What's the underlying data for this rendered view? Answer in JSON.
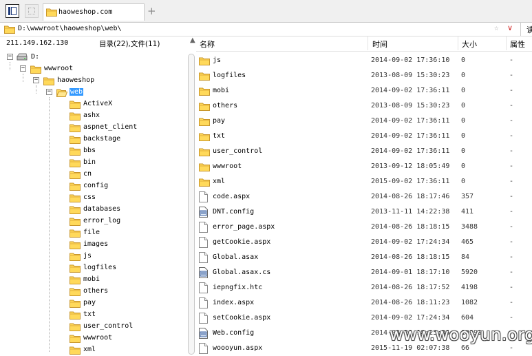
{
  "tab": {
    "title": "haoweshop.com",
    "plus": "+"
  },
  "address": {
    "path": "D:\\wwwroot\\haoweshop\\web\\",
    "star": "☆",
    "chevron": "∨",
    "go": "读"
  },
  "status": {
    "ip": "211.149.162.130",
    "counts": "目录(22),文件(11)"
  },
  "columns": {
    "name": "名称",
    "time": "时间",
    "size": "大小",
    "attr": "属性"
  },
  "tree": {
    "drive": "D:",
    "wwwroot": "wwwroot",
    "haoweshop": "haoweshop",
    "web": "web",
    "children": [
      "ActiveX",
      "ashx",
      "aspnet_client",
      "backstage",
      "bbs",
      "bin",
      "cn",
      "config",
      "css",
      "databases",
      "error_log",
      "file",
      "images",
      "js",
      "logfiles",
      "mobi",
      "others",
      "pay",
      "txt",
      "user_control",
      "wwwroot",
      "xml"
    ]
  },
  "files": [
    {
      "name": "js",
      "time": "2014-09-02 17:36:10",
      "size": "0",
      "attr": "-",
      "type": "folder"
    },
    {
      "name": "logfiles",
      "time": "2013-08-09 15:30:23",
      "size": "0",
      "attr": "-",
      "type": "folder"
    },
    {
      "name": "mobi",
      "time": "2014-09-02 17:36:11",
      "size": "0",
      "attr": "-",
      "type": "folder"
    },
    {
      "name": "others",
      "time": "2013-08-09 15:30:23",
      "size": "0",
      "attr": "-",
      "type": "folder"
    },
    {
      "name": "pay",
      "time": "2014-09-02 17:36:11",
      "size": "0",
      "attr": "-",
      "type": "folder"
    },
    {
      "name": "txt",
      "time": "2014-09-02 17:36:11",
      "size": "0",
      "attr": "-",
      "type": "folder"
    },
    {
      "name": "user_control",
      "time": "2014-09-02 17:36:11",
      "size": "0",
      "attr": "-",
      "type": "folder"
    },
    {
      "name": "wwwroot",
      "time": "2013-09-12 18:05:49",
      "size": "0",
      "attr": "-",
      "type": "folder"
    },
    {
      "name": "xml",
      "time": "2015-09-02 17:36:11",
      "size": "0",
      "attr": "-",
      "type": "folder"
    },
    {
      "name": "code.aspx",
      "time": "2014-08-26 18:17:46",
      "size": "357",
      "attr": "-",
      "type": "file"
    },
    {
      "name": "DNT.config",
      "time": "2013-11-11 14:22:38",
      "size": "411",
      "attr": "-",
      "type": "config"
    },
    {
      "name": "error_page.aspx",
      "time": "2014-08-26 18:18:15",
      "size": "3488",
      "attr": "-",
      "type": "file"
    },
    {
      "name": "getCookie.aspx",
      "time": "2014-09-02 17:24:34",
      "size": "465",
      "attr": "-",
      "type": "file"
    },
    {
      "name": "Global.asax",
      "time": "2014-08-26 18:18:15",
      "size": "84",
      "attr": "-",
      "type": "file"
    },
    {
      "name": "Global.asax.cs",
      "time": "2014-09-01 18:17:10",
      "size": "5920",
      "attr": "-",
      "type": "config"
    },
    {
      "name": "iepngfix.htc",
      "time": "2014-08-26 18:17:52",
      "size": "4198",
      "attr": "-",
      "type": "file"
    },
    {
      "name": "index.aspx",
      "time": "2014-08-26 18:11:23",
      "size": "1082",
      "attr": "-",
      "type": "file"
    },
    {
      "name": "setCookie.aspx",
      "time": "2014-09-02 17:24:34",
      "size": "604",
      "attr": "-",
      "type": "file"
    },
    {
      "name": "Web.config",
      "time": "2014-08-26 18:25:36",
      "size": "10999",
      "attr": "-",
      "type": "config"
    },
    {
      "name": "woooyun.aspx",
      "time": "2015-11-19 02:07:38",
      "size": "66",
      "attr": "-",
      "type": "file"
    }
  ],
  "watermark": "www.wooyun.org"
}
